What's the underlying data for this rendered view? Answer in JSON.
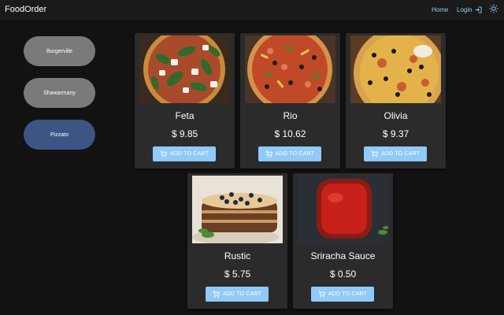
{
  "app": {
    "brand": "FoodOrder"
  },
  "nav": {
    "home": "Home",
    "login": "Login"
  },
  "shops": [
    {
      "label": "Burgerville"
    },
    {
      "label": "Shawarmany"
    },
    {
      "label": "Pizzato",
      "active": true
    }
  ],
  "products": [
    {
      "name": "Feta",
      "price": "$ 9.85",
      "button": "ADD TO CART"
    },
    {
      "name": "Rio",
      "price": "$ 10.62",
      "button": "ADD TO CART"
    },
    {
      "name": "Olivia",
      "price": "$ 9.37",
      "button": "ADD TO CART"
    },
    {
      "name": "Rustic",
      "price": "$ 5.75",
      "button": "ADD TO CART"
    },
    {
      "name": "Sriracha Sauce",
      "price": "$ 0.50",
      "button": "ADD TO CART"
    }
  ],
  "colors": {
    "accent": "#90caf9",
    "active_shop": "#3d5585",
    "shop": "#7a7a7a",
    "card": "#2b2b2b",
    "nav_link": "#8fd0ff"
  }
}
